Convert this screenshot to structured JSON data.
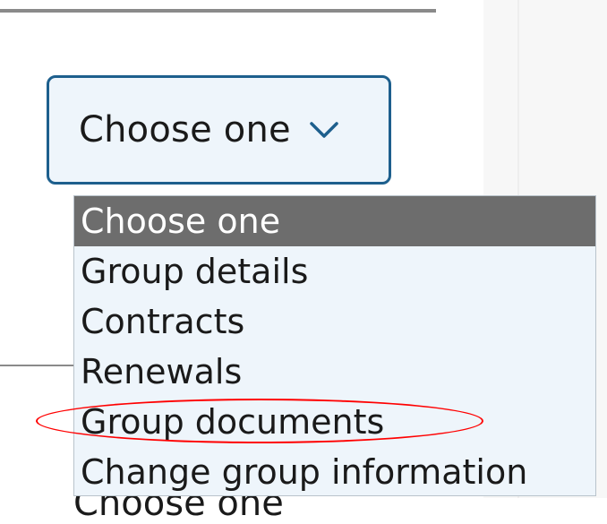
{
  "select": {
    "value": "Choose one",
    "icon": "chevron-down-icon"
  },
  "dropdown": {
    "options": [
      {
        "label": "Choose one",
        "selected": true
      },
      {
        "label": "Group details",
        "selected": false
      },
      {
        "label": "Contracts",
        "selected": false
      },
      {
        "label": "Renewals",
        "selected": false
      },
      {
        "label": "Group documents",
        "selected": false
      },
      {
        "label": "Change group information",
        "selected": false
      }
    ]
  },
  "background": {
    "partial_text": "Choose one"
  },
  "annotation": {
    "highlighted_option": "Group documents",
    "color": "#ff0000"
  },
  "colors": {
    "select_border": "#1d5f8d",
    "select_background": "#eef5fb",
    "selected_option_background": "#6d6d6d",
    "selected_option_text": "#ffffff"
  }
}
